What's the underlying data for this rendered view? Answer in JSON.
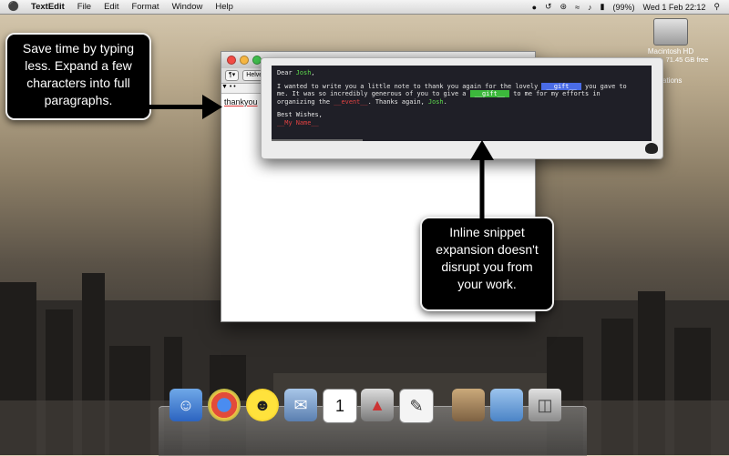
{
  "menubar": {
    "app": "TextEdit",
    "items": [
      "File",
      "Edit",
      "Format",
      "Window",
      "Help"
    ],
    "battery": "(99%)",
    "datetime": "Wed 1 Feb  22:12"
  },
  "desktop": {
    "disk_name": "Macintosh HD",
    "disk_info": "159.7 GB, 71.45 GB free",
    "partial_label": "ations"
  },
  "textedit": {
    "font_button": "Helve",
    "doc_text": "thankyou"
  },
  "snippet": {
    "greeting_prefix": "Dear ",
    "greeting_name": "Josh",
    "greeting_suffix": ",",
    "line1_prefix": "I wanted to write you a little note to thank you again for the lovely ",
    "field_gift_1": " __gift__ ",
    "line1_suffix": " you gave to",
    "line2_prefix": "me. It was so incredibly generous of you to give a ",
    "field_gift_2": " __gift__ ",
    "line2_suffix": " to me for my efforts in",
    "line3_prefix": "organizing the ",
    "field_event": "__event__",
    "line3_mid": ". Thanks again, ",
    "line3_name": "Josh",
    "line3_suffix": ".",
    "closing": "Best Wishes,",
    "signature": "__My Name__"
  },
  "callouts": {
    "left": "Save time by typing less. Expand a few characters into full paragraphs.",
    "right": "Inline snippet expansion doesn't disrupt you from your work."
  }
}
